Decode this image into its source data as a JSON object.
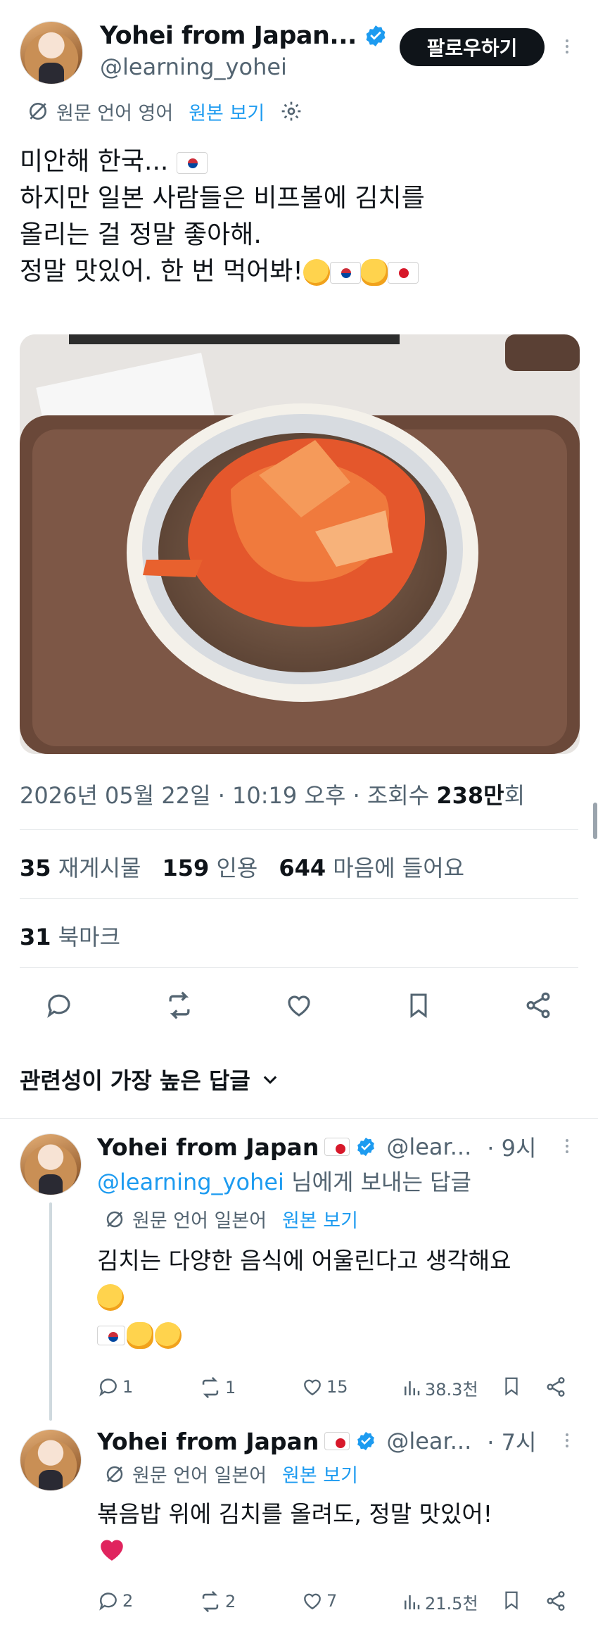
{
  "main_post": {
    "author_name": "Yohei from Japan...",
    "handle": "@learning_yohei",
    "follow_label": "팔로우하기",
    "translate": {
      "source_lang_text": "원문 언어 영어",
      "show_original": "원본 보기"
    },
    "body_lines": [
      "미안해 한국...",
      "하지만 일본 사람들은 비프볼에 김치를",
      "올리는 걸 정말 좋아해.",
      "정말 맛있어. 한 번 먹어봐!"
    ],
    "timestamp": "2026년 05월 22일 · 10:19 오후 · 조회수",
    "views_bold": "238만",
    "views_suffix": "회",
    "reposts_count": "35",
    "reposts_label": "재게시물",
    "quotes_count": "159",
    "quotes_label": "인용",
    "likes_count": "644",
    "likes_label": "마음에 들어요",
    "bookmarks_count": "31",
    "bookmarks_label": "북마크"
  },
  "replies_header": "관련성이 가장 높은 답글",
  "replies": [
    {
      "author_name": "Yohei from Japan",
      "handle": "@lear...",
      "time": "· 9시",
      "reply_to_handle": "@learning_yohei",
      "reply_to_suffix": "님에게 보내는 답글",
      "source_lang_text": "원문 언어 일본어",
      "show_original": "원본 보기",
      "text": "김치는 다양한 음식에 어울린다고 생각해요",
      "stats": {
        "replies": "1",
        "reposts": "1",
        "likes": "15",
        "views": "38.3천"
      }
    },
    {
      "author_name": "Yohei from Japan",
      "handle": "@lear...",
      "time": "· 7시",
      "source_lang_text": "원문 언어 일본어",
      "show_original": "원본 보기",
      "text": "볶음밥 위에 김치를 올려도, 정말 맛있어!",
      "stats": {
        "replies": "2",
        "reposts": "2",
        "likes": "7",
        "views": "21.5천"
      }
    }
  ],
  "colors": {
    "accent": "#1d9bf0",
    "text": "#0f1419",
    "muted": "#536471",
    "follow_bg": "#0f1419"
  }
}
